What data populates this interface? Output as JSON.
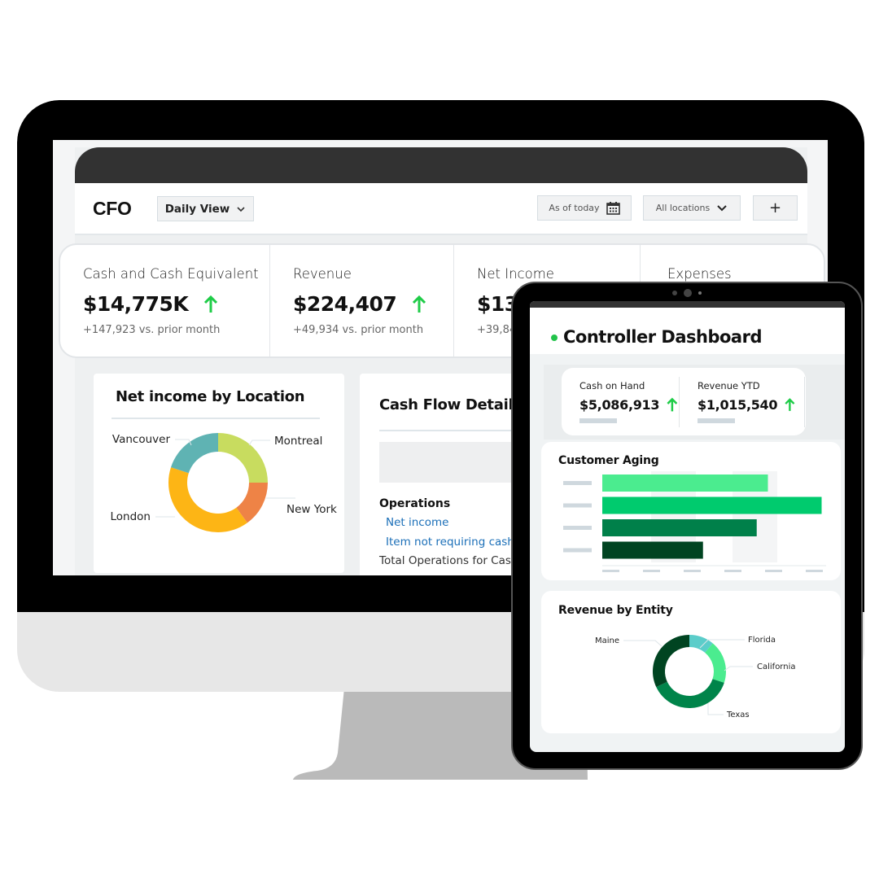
{
  "monitor": {
    "app_title": "CFO",
    "view_select": {
      "label": "Daily View",
      "icon": "chevron-down-icon"
    },
    "date_filter": {
      "label": "As of today",
      "icon": "calendar-icon"
    },
    "location_filter": {
      "label": "All locations",
      "icon": "chevron-down-icon"
    },
    "add_button": {
      "label": "+"
    },
    "kpis": [
      {
        "label": "Cash and Cash Equivalent",
        "value": "$14,775K",
        "trend": "up",
        "delta": "+147,923 vs. prior month"
      },
      {
        "label": "Revenue",
        "value": "$224,407",
        "trend": "up",
        "delta": "+49,934 vs. prior month"
      },
      {
        "label": "Net Income",
        "value": "$13",
        "trend": "up",
        "delta": "+39,84"
      },
      {
        "label": "Expenses",
        "value": "",
        "trend": "",
        "delta": ""
      }
    ],
    "net_income_panel": {
      "title": "Net income by Location"
    },
    "cash_flow_panel": {
      "title": "Cash Flow Detail",
      "section": "Operations",
      "links": [
        "Net income",
        "Item not requiring cash -"
      ],
      "total": "Total Operations for Cash"
    }
  },
  "tablet": {
    "title": "Controller Dashboard",
    "kpis": [
      {
        "label": "Cash on Hand",
        "value": "$5,086,913",
        "trend": "up"
      },
      {
        "label": "Revenue YTD",
        "value": "$1,015,540",
        "trend": "up"
      }
    ],
    "customer_aging_title": "Customer Aging",
    "revenue_entity_title": "Revenue by Entity"
  },
  "colors": {
    "trend_up": "#1fcc48",
    "link": "#1b6fb8"
  },
  "chart_data": [
    {
      "id": "net-income-by-location",
      "type": "pie",
      "donut": true,
      "title": "Net income by Location",
      "categories": [
        "Montreal",
        "New York",
        "London",
        "Vancouver"
      ],
      "values": [
        25,
        15,
        40,
        20
      ],
      "unit": "percent (estimated)",
      "colors": [
        "#c8dc5f",
        "#ee8346",
        "#fdb515",
        "#5fb3b3"
      ]
    },
    {
      "id": "customer-aging",
      "type": "bar",
      "orientation": "horizontal",
      "title": "Customer Aging",
      "categories": [
        "",
        "",
        "",
        ""
      ],
      "values": [
        0.74,
        0.98,
        0.69,
        0.45
      ],
      "xlim": [
        0,
        1
      ],
      "unit": "fraction of axis (labels hidden)",
      "colors": [
        "#4bec8f",
        "#00cb6e",
        "#00804a",
        "#004421"
      ]
    },
    {
      "id": "revenue-by-entity",
      "type": "pie",
      "donut": true,
      "title": "Revenue by Entity",
      "categories": [
        "Florida",
        "California",
        "Texas",
        "Maine"
      ],
      "values": [
        11,
        19,
        38,
        32
      ],
      "unit": "percent (estimated)",
      "colors": [
        "#5bcdca",
        "#4bec8f",
        "#00844a",
        "#004421"
      ]
    }
  ]
}
